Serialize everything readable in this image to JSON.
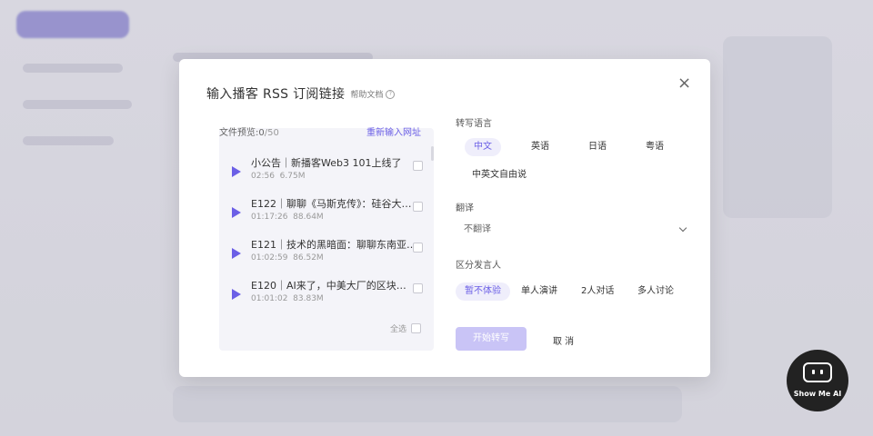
{
  "dialog": {
    "title": "输入播客 RSS 订阅链接",
    "help_label": "帮助文档",
    "help_icon": "question-circle-icon",
    "close_icon": "close-icon"
  },
  "preview": {
    "label": "文件预览:",
    "selected": "0",
    "total": "/50",
    "reinput_label": "重新输入网址",
    "select_all_label": "全选",
    "episodes": [
      {
        "title": "小公告｜新播客Web3 101上线了",
        "duration": "02:56",
        "size": "6.75M"
      },
      {
        "title": "E122｜聊聊《马斯克传》：硅谷大…",
        "duration": "01:17:26",
        "size": "88.64M"
      },
      {
        "title": "E121｜技术的黑暗面：聊聊东南亚…",
        "duration": "01:02:59",
        "size": "86.52M"
      },
      {
        "title": "E120｜AI来了，中美大厂的区块…",
        "duration": "01:01:02",
        "size": "83.83M"
      }
    ]
  },
  "transcribe_language": {
    "label": "转写语言",
    "options": [
      "中文",
      "英语",
      "日语",
      "粤语",
      "中英文自由说"
    ],
    "selected": "中文"
  },
  "translate": {
    "label": "翻译",
    "value": "不翻译"
  },
  "speakers": {
    "label": "区分发言人",
    "options": [
      "暂不体验",
      "单人演讲",
      "2人对话",
      "多人讨论"
    ],
    "selected": "暂不体验"
  },
  "actions": {
    "start_label": "开始转写",
    "cancel_label": "取 消"
  },
  "badge": {
    "label": "Show Me AI"
  },
  "colors": {
    "accent": "#6b5fe6",
    "accent_light": "#efeefb",
    "disabled_button": "#c9c4f6"
  }
}
